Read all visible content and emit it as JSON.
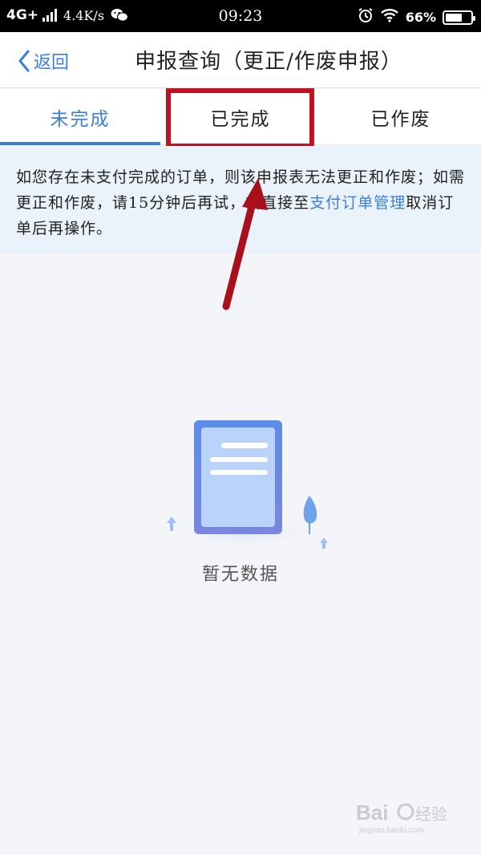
{
  "status_bar": {
    "network": "4G+",
    "speed": "4.4K/s",
    "time": "09:23",
    "battery_percent": "66%",
    "battery_level": 0.66,
    "icons": [
      "signal-icon",
      "wechat-icon",
      "alarm-icon",
      "wifi-icon",
      "battery-icon"
    ]
  },
  "header": {
    "back_label": "返回",
    "title": "申报查询（更正/作废申报）"
  },
  "tabs": [
    {
      "label": "未完成",
      "active": true
    },
    {
      "label": "已完成",
      "active": false
    },
    {
      "label": "已作废",
      "active": false
    }
  ],
  "notice": {
    "text_before": "如您存在未支付完成的订单，则该申报表无法更正和作废；如需更正和作废，请15分钟后再试，或直接至",
    "link": "支付订单管理",
    "text_after": "取消订单后再操作。"
  },
  "empty_state": {
    "text": "暂无数据"
  },
  "colors": {
    "accent": "#3b7ede",
    "annotation": "#c1121f",
    "notice_bg": "#eaf2fb",
    "page_bg": "#f4f5f9"
  }
}
